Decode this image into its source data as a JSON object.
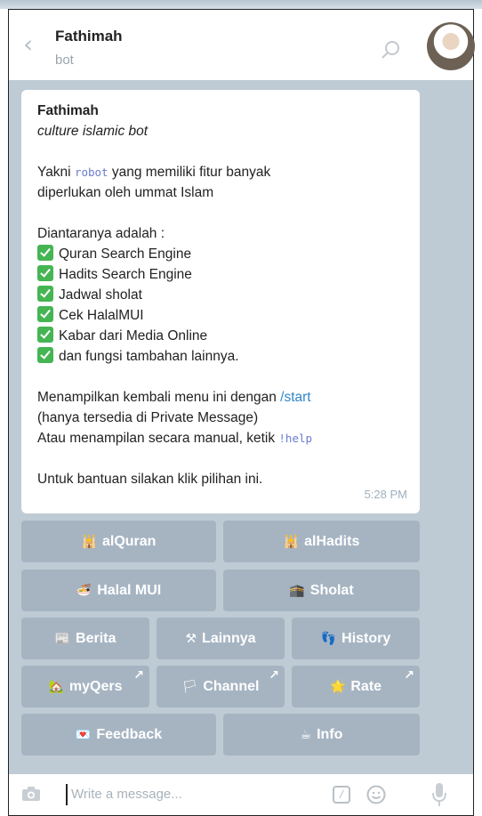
{
  "header": {
    "title": "Fathimah",
    "subtitle": "bot"
  },
  "message": {
    "name": "Fathimah",
    "tagline": "culture islamic bot",
    "intro_1": "Yakni ",
    "intro_code": "robot",
    "intro_2": " yang memiliki fitur banyak",
    "intro_3": "diperlukan oleh ummat Islam",
    "list_heading": "Diantaranya adalah :",
    "features": [
      "Quran Search Engine",
      "Hadits Search Engine",
      "Jadwal sholat",
      "Cek HalalMUI",
      "Kabar dari Media Online",
      "dan fungsi tambahan lainnya."
    ],
    "menu_text": "Menampilkan kembali menu ini dengan ",
    "menu_link": "/start",
    "private_note": "(hanya tersedia di Private Message)",
    "manual_text": "Atau menampilan secara manual, ketik ",
    "manual_code": "!help",
    "help_text": "Untuk bantuan silakan klik pilihan ini.",
    "time": "5:28 PM"
  },
  "keyboard": {
    "alquran": "alQuran",
    "alhadits": "alHadits",
    "halal": "Halal MUI",
    "sholat": "Sholat",
    "berita": "Berita",
    "lainnya": "Lainnya",
    "history": "History",
    "myqers": "myQers",
    "channel": "Channel",
    "rate": "Rate",
    "feedback": "Feedback",
    "info": "Info"
  },
  "composer": {
    "placeholder": "Write a message..."
  }
}
